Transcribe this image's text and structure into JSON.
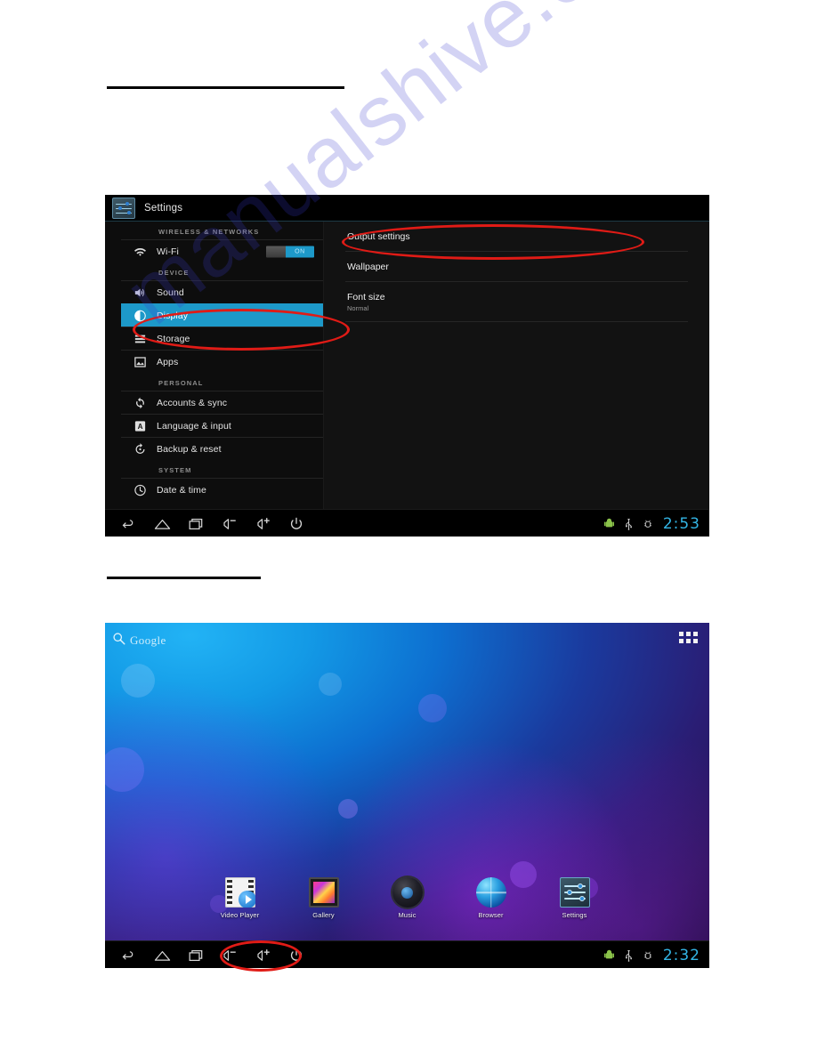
{
  "page": {
    "watermark": "manualshive.com"
  },
  "settings_screenshot": {
    "title_bar": {
      "icon": "settings-sliders-icon",
      "title": "Settings"
    },
    "sidebar": {
      "groups": [
        {
          "header": "WIRELESS & NETWORKS",
          "items": [
            {
              "label": "Wi-Fi",
              "icon": "wifi-icon",
              "toggle": "ON",
              "selected": false
            }
          ]
        },
        {
          "header": "DEVICE",
          "items": [
            {
              "label": "Sound",
              "icon": "sound-icon",
              "selected": false
            },
            {
              "label": "Display",
              "icon": "display-icon",
              "selected": true
            },
            {
              "label": "Storage",
              "icon": "storage-icon",
              "selected": false
            },
            {
              "label": "Apps",
              "icon": "apps-icon",
              "selected": false
            }
          ]
        },
        {
          "header": "PERSONAL",
          "items": [
            {
              "label": "Accounts & sync",
              "icon": "sync-icon",
              "selected": false
            },
            {
              "label": "Language & input",
              "icon": "language-icon",
              "selected": false
            },
            {
              "label": "Backup & reset",
              "icon": "backup-icon",
              "selected": false
            }
          ]
        },
        {
          "header": "SYSTEM",
          "items": [
            {
              "label": "Date & time",
              "icon": "clock-icon",
              "selected": false
            }
          ]
        }
      ]
    },
    "content": {
      "items": [
        {
          "title": "Output settings",
          "subtitle": ""
        },
        {
          "title": "Wallpaper",
          "subtitle": ""
        },
        {
          "title": "Font size",
          "subtitle": "Normal"
        }
      ]
    },
    "navbar": {
      "buttons": [
        {
          "icon": "back-icon"
        },
        {
          "icon": "home-icon"
        },
        {
          "icon": "recents-icon"
        },
        {
          "icon": "volume-down-icon"
        },
        {
          "icon": "volume-up-icon"
        },
        {
          "icon": "power-icon"
        }
      ],
      "status_icons": [
        {
          "icon": "android-robot-icon"
        },
        {
          "icon": "usb-icon"
        },
        {
          "icon": "adb-debug-icon"
        }
      ],
      "clock": "2:53"
    },
    "annotations": [
      {
        "name": "output-settings-highlight",
        "target": "Output settings"
      },
      {
        "name": "display-highlight",
        "target": "Display"
      }
    ]
  },
  "home_screenshot": {
    "search": {
      "icon": "search-icon",
      "label": "Google"
    },
    "app_drawer": {
      "icon": "app-drawer-grid-icon"
    },
    "dock_apps": [
      {
        "label": "Video Player",
        "icon": "video-player-icon"
      },
      {
        "label": "Gallery",
        "icon": "gallery-icon"
      },
      {
        "label": "Music",
        "icon": "music-icon"
      },
      {
        "label": "Browser",
        "icon": "browser-icon"
      },
      {
        "label": "Settings",
        "icon": "settings-icon"
      }
    ],
    "navbar": {
      "buttons": [
        {
          "icon": "back-icon"
        },
        {
          "icon": "home-icon"
        },
        {
          "icon": "recents-icon"
        },
        {
          "icon": "volume-down-icon"
        },
        {
          "icon": "volume-up-icon"
        },
        {
          "icon": "power-icon"
        }
      ],
      "status_icons": [
        {
          "icon": "android-robot-icon"
        },
        {
          "icon": "usb-icon"
        },
        {
          "icon": "adb-debug-icon"
        }
      ],
      "clock": "2:32"
    },
    "annotations": [
      {
        "name": "volume-buttons-highlight",
        "target": "volume buttons"
      }
    ]
  },
  "colors": {
    "accent_blue": "#1d99c9",
    "clock_cyan": "#33b5e5",
    "annotation_red": "#e01b16",
    "watermark_blue": "#3a3ad0"
  }
}
